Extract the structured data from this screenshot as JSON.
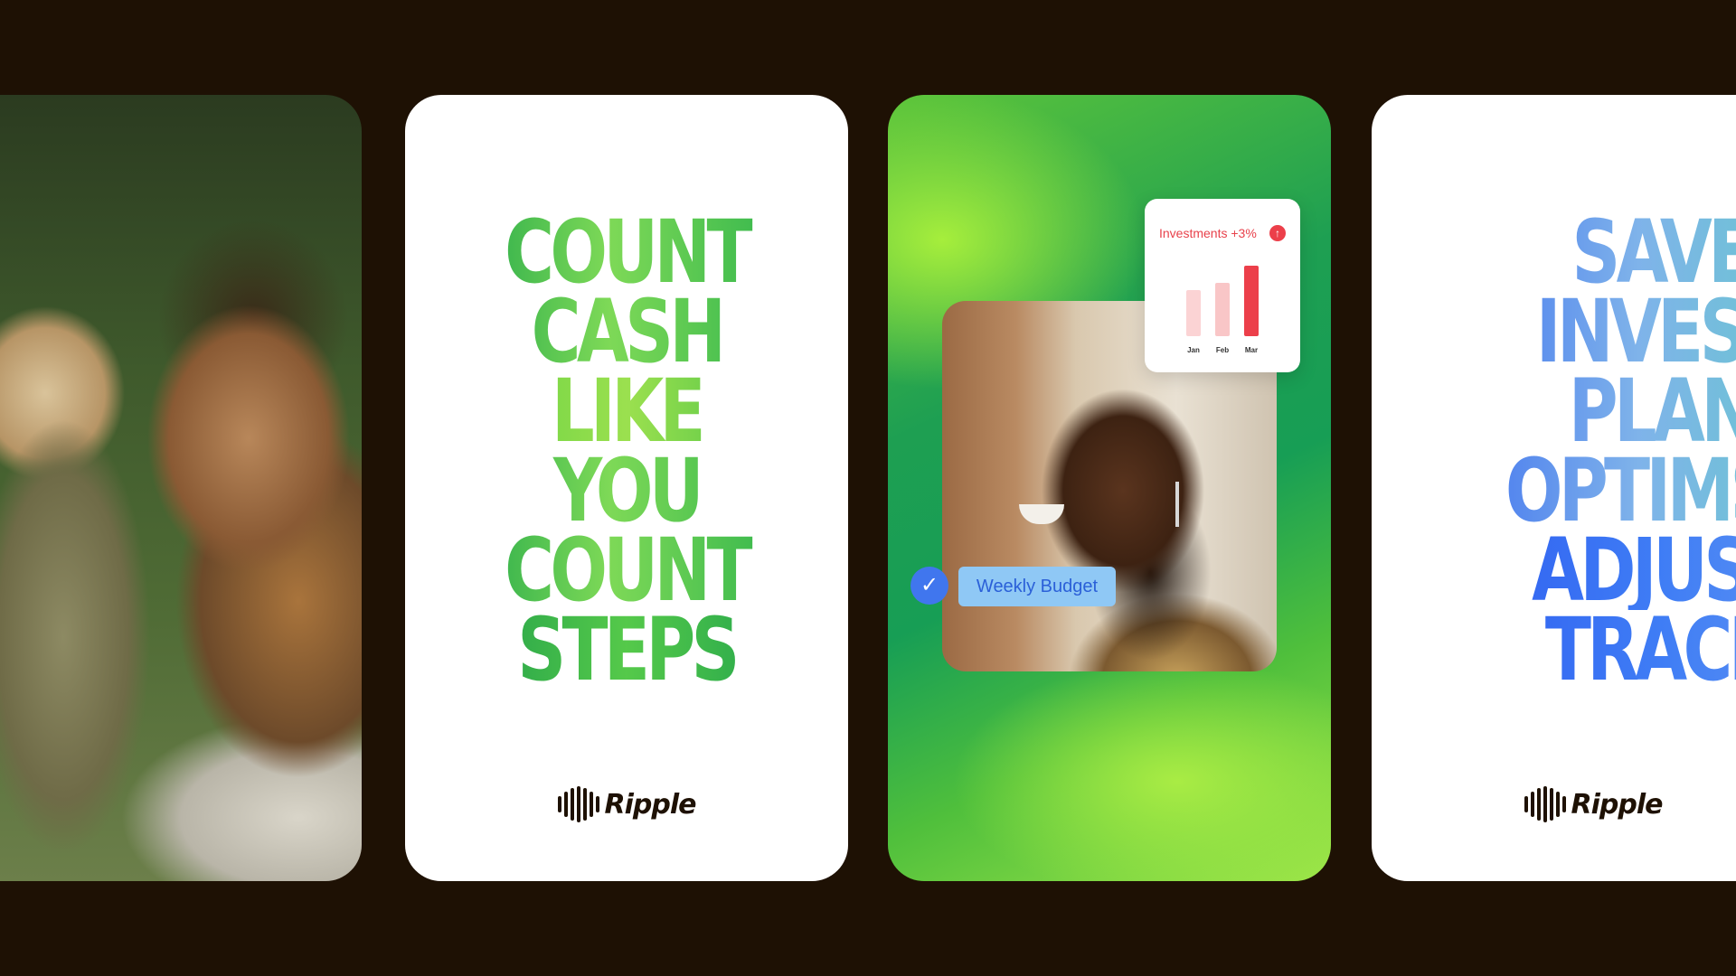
{
  "card_count": {
    "headline": [
      "COUNT",
      "CASH",
      "LIKE",
      "YOU",
      "COUNT",
      "STEPS"
    ],
    "brand": "Ripple"
  },
  "card_budget": {
    "investments_label": "Investments +3%",
    "chart_data": {
      "type": "bar",
      "categories": [
        "Jan",
        "Feb",
        "Mar"
      ],
      "values": [
        0.65,
        0.75,
        1.0
      ],
      "colors": [
        "#fbd3d4",
        "#f9c6c7",
        "#ec3f4a"
      ]
    },
    "budget_label": "Weekly Budget"
  },
  "card_save": {
    "headline": [
      "SAVE",
      "INVEST",
      "PLAN",
      "OPTIMSE",
      "ADJUST",
      "TRACK"
    ],
    "brand": "Ripple"
  },
  "colors": {
    "background": "#1e1104",
    "green_accent": "#22a84a",
    "blue_accent": "#3d6ef0",
    "investments_red": "#e8414b",
    "budget_blue": "#8fc8f5"
  }
}
